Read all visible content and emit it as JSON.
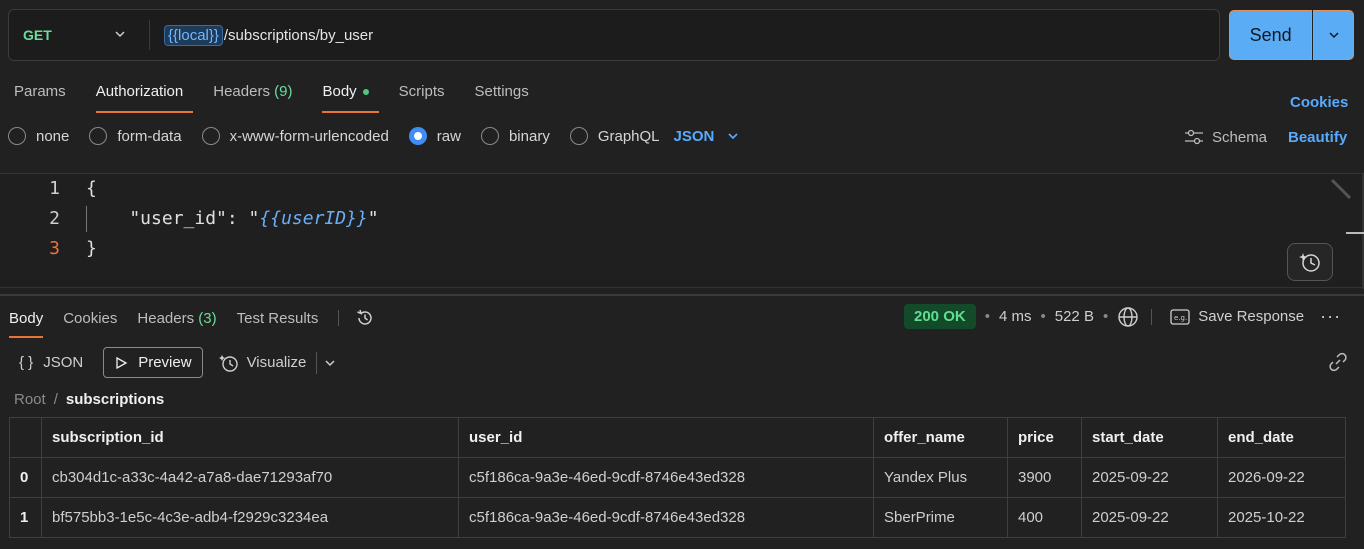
{
  "request": {
    "method": "GET",
    "url_variable": "{{local}}",
    "url_path": "/subscriptions/by_user",
    "send_label": "Send"
  },
  "request_tabs": {
    "params": "Params",
    "authorization": "Authorization",
    "headers": "Headers",
    "headers_count": "(9)",
    "body": "Body",
    "scripts": "Scripts",
    "settings": "Settings",
    "cookies": "Cookies"
  },
  "body_types": {
    "none": "none",
    "form_data": "form-data",
    "urlencoded": "x-www-form-urlencoded",
    "raw": "raw",
    "binary": "binary",
    "graphql": "GraphQL",
    "format": "JSON",
    "selected": "raw",
    "schema": "Schema",
    "beautify": "Beautify"
  },
  "editor": {
    "line1_num": "1",
    "line2_num": "2",
    "line3_num": "3",
    "line1": "{",
    "line2_key": "    \"user_id\": \"",
    "line2_var": "{{userID}}",
    "line2_end": "\"",
    "line3": "}"
  },
  "response_tabs": {
    "body": "Body",
    "cookies": "Cookies",
    "headers": "Headers",
    "headers_count": "(3)",
    "test_results": "Test Results"
  },
  "response_status": {
    "status": "200 OK",
    "time": "4 ms",
    "size": "522 B",
    "save_response": "Save Response"
  },
  "view_bar": {
    "json": "JSON",
    "preview": "Preview",
    "visualize": "Visualize"
  },
  "breadcrumb": {
    "root": "Root",
    "current": "subscriptions"
  },
  "table": {
    "columns": [
      "subscription_id",
      "user_id",
      "offer_name",
      "price",
      "start_date",
      "end_date"
    ],
    "rows": [
      {
        "index": "0",
        "subscription_id": "cb304d1c-a33c-4a42-a7a8-dae71293af70",
        "user_id": "c5f186ca-9a3e-46ed-9cdf-8746e43ed328",
        "offer_name": "Yandex Plus",
        "price": "3900",
        "start_date": "2025-09-22",
        "end_date": "2026-09-22"
      },
      {
        "index": "1",
        "subscription_id": "bf575bb3-1e5c-4c3e-adb4-f2929c3234ea",
        "user_id": "c5f186ca-9a3e-46ed-9cdf-8746e43ed328",
        "offer_name": "SberPrime",
        "price": "400",
        "start_date": "2025-09-22",
        "end_date": "2025-10-22"
      }
    ]
  },
  "colors": {
    "accent": "#e9743a",
    "link": "#58aaff",
    "method_get": "#6bdd9a",
    "send": "#5aacf5",
    "status_ok": "#5ee08e"
  }
}
